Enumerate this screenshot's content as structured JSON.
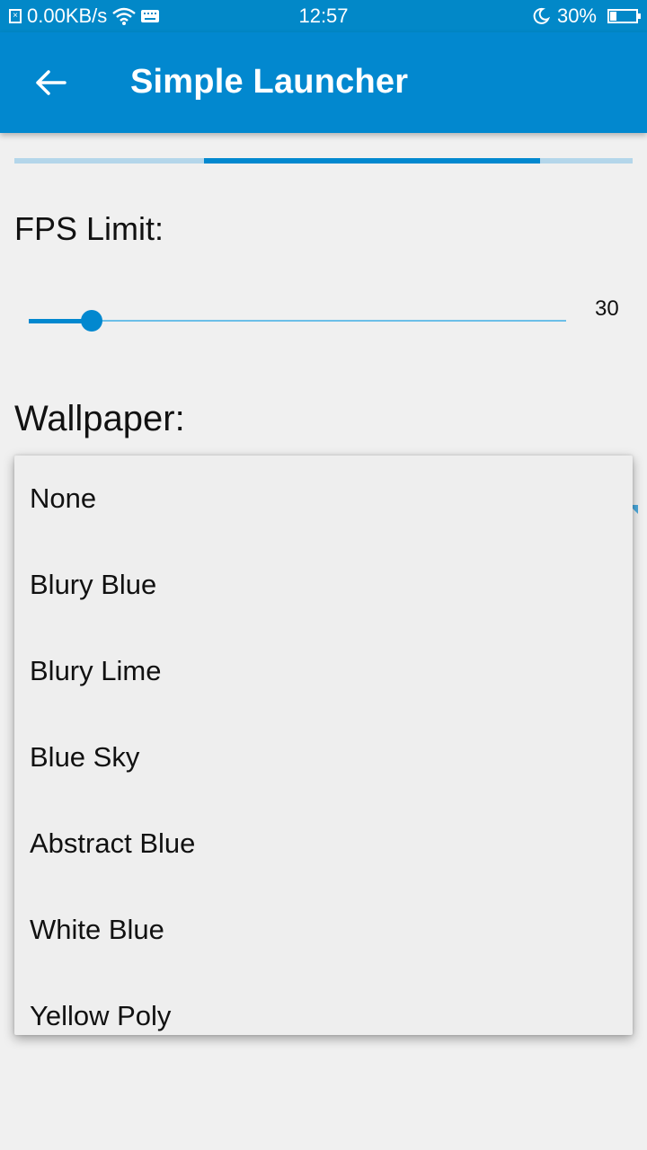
{
  "status_bar": {
    "speed": "0.00KB/s",
    "time": "12:57",
    "battery_text": "30%",
    "battery_level": 0.3,
    "icons": [
      "notification-icon",
      "wifi-icon",
      "keyboard-icon",
      "moon-icon",
      "battery-icon"
    ]
  },
  "app_bar": {
    "title": "Simple Launcher",
    "back_icon": "arrow-left-icon",
    "color": "#0288cf"
  },
  "progress": {
    "start": 0.307,
    "end": 0.851
  },
  "fps": {
    "label": "FPS Limit:",
    "value": "30",
    "slider_fraction": 0.117
  },
  "wallpaper": {
    "label": "Wallpaper:",
    "options": [
      "None",
      "Blury Blue",
      "Blury Lime",
      "Blue Sky",
      "Abstract Blue",
      "White Blue",
      "Yellow Poly"
    ]
  },
  "colors": {
    "accent": "#0288cf",
    "track_light": "#b4d6ea",
    "background": "#f0f0f0"
  }
}
